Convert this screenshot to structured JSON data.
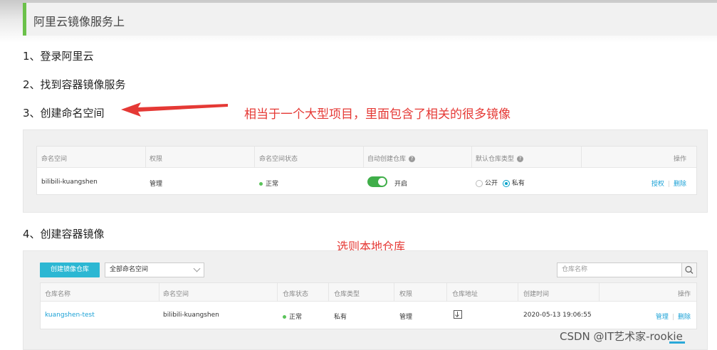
{
  "header": {
    "title": "阿里云镜像服务上"
  },
  "steps": [
    "1、登录阿里云",
    "2、找到容器镜像服务",
    "3、创建命名空间",
    "4、创建容器镜像"
  ],
  "annotations": {
    "namespace_note": "相当于一个大型项目，里面包含了相关的很多镜像",
    "repo_note": "选则本地仓库"
  },
  "namespace_table": {
    "headers": [
      "命名空间",
      "权限",
      "命名空间状态",
      "自动创建仓库",
      "默认仓库类型",
      "操作"
    ],
    "row": {
      "name": "bilibili-kuangshen",
      "permission": "管理",
      "status": "正常",
      "auto_create": "开启",
      "repo_type_public": "公开",
      "repo_type_private": "私有",
      "action_auth": "授权",
      "action_delete": "删除"
    }
  },
  "repo_toolbar": {
    "create_button": "创建镜像仓库",
    "namespace_select": "全部命名空间",
    "search_placeholder": "仓库名称"
  },
  "repo_table": {
    "headers": [
      "仓库名称",
      "命名空间",
      "仓库状态",
      "仓库类型",
      "权限",
      "仓库地址",
      "创建时间",
      "操作"
    ],
    "row": {
      "name": "kuangshen-test",
      "namespace": "bilibili-kuangshen",
      "status": "正常",
      "type": "私有",
      "permission": "管理",
      "created": "2020-05-13 19:06:55",
      "action_manage": "管理",
      "action_delete": "删除"
    }
  },
  "watermark": "CSDN @IT艺术家-rookie",
  "colors": {
    "accent_green": "#6bc14a",
    "annotation_red": "#e53935",
    "primary_blue": "#2cb7d3",
    "status_green": "#5ac35a"
  }
}
